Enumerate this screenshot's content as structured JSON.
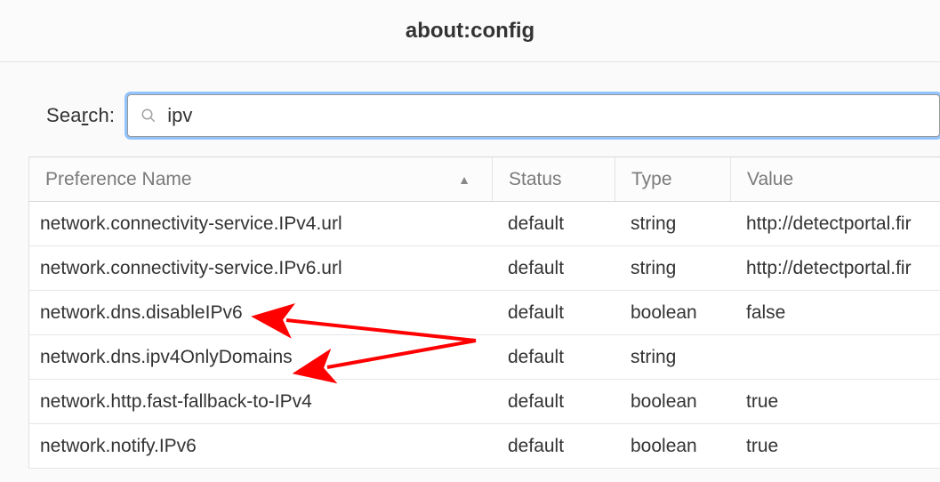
{
  "title": "about:config",
  "search": {
    "label_pre": "Sea",
    "label_ul": "r",
    "label_post": "ch:",
    "value": "ipv"
  },
  "columns": {
    "name": "Preference Name",
    "status": "Status",
    "type": "Type",
    "value": "Value",
    "sort_indicator": "▲"
  },
  "rows": [
    {
      "name": "network.connectivity-service.IPv4.url",
      "status": "default",
      "type": "string",
      "value": "http://detectportal.fir"
    },
    {
      "name": "network.connectivity-service.IPv6.url",
      "status": "default",
      "type": "string",
      "value": "http://detectportal.fir"
    },
    {
      "name": "network.dns.disableIPv6",
      "status": "default",
      "type": "boolean",
      "value": "false"
    },
    {
      "name": "network.dns.ipv4OnlyDomains",
      "status": "default",
      "type": "string",
      "value": ""
    },
    {
      "name": "network.http.fast-fallback-to-IPv4",
      "status": "default",
      "type": "boolean",
      "value": "true"
    },
    {
      "name": "network.notify.IPv6",
      "status": "default",
      "type": "boolean",
      "value": "true"
    }
  ]
}
